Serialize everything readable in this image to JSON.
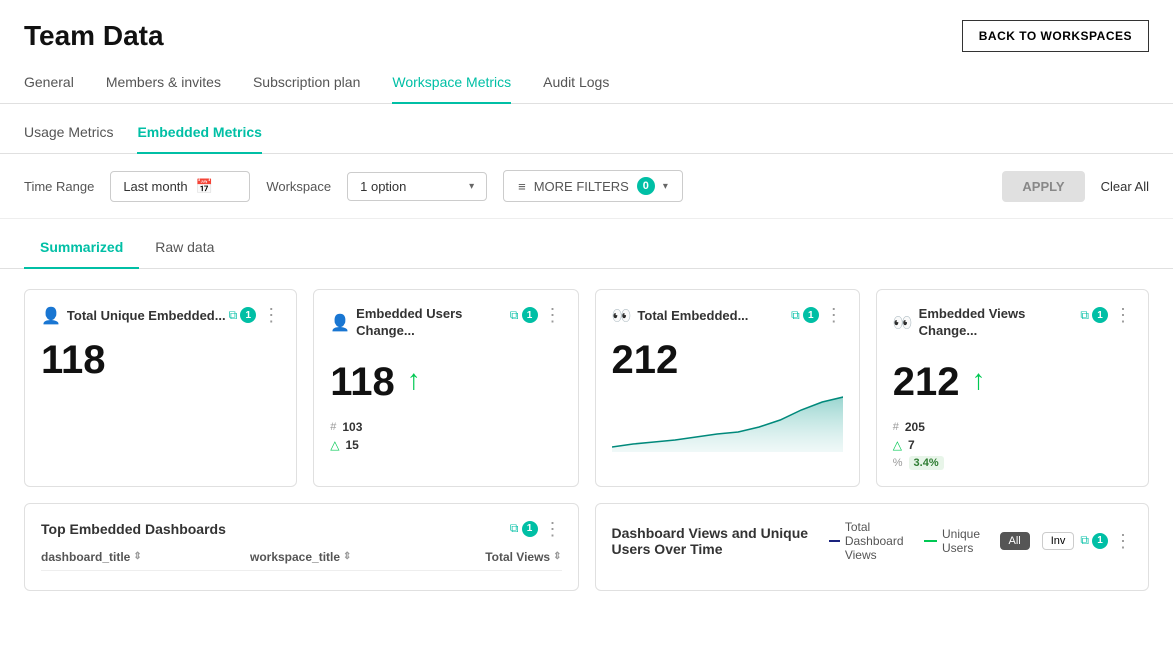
{
  "page": {
    "title": "Team Data",
    "back_button": "BACK TO WORKSPACES"
  },
  "nav": {
    "tabs": [
      {
        "id": "general",
        "label": "General",
        "active": false
      },
      {
        "id": "members",
        "label": "Members & invites",
        "active": false
      },
      {
        "id": "subscription",
        "label": "Subscription plan",
        "active": false
      },
      {
        "id": "workspace-metrics",
        "label": "Workspace Metrics",
        "active": true
      },
      {
        "id": "audit-logs",
        "label": "Audit Logs",
        "active": false
      }
    ]
  },
  "sub_tabs": [
    {
      "id": "usage",
      "label": "Usage Metrics",
      "active": false
    },
    {
      "id": "embedded",
      "label": "Embedded Metrics",
      "active": true
    }
  ],
  "filters": {
    "time_range_label": "Time Range",
    "time_range_value": "Last month",
    "workspace_label": "Workspace",
    "workspace_value": "1 option",
    "more_filters_label": "MORE FILTERS",
    "more_filters_count": "0",
    "apply_label": "APPLY",
    "clear_label": "Clear All"
  },
  "view_tabs": [
    {
      "id": "summarized",
      "label": "Summarized",
      "active": true
    },
    {
      "id": "raw",
      "label": "Raw data",
      "active": false
    }
  ],
  "metrics": [
    {
      "id": "total-unique-embedded",
      "icon": "👤",
      "title": "Total Unique Embedded...",
      "filter_count": "1",
      "value": "118",
      "has_trend": false,
      "has_chart": false,
      "has_sub": false
    },
    {
      "id": "embedded-users-change",
      "icon": "👤",
      "title": "Embedded Users Change...",
      "filter_count": "1",
      "value": "118",
      "trend": "up",
      "sub1_label": "#",
      "sub1_value": "103",
      "sub2_value": "15",
      "has_chart": false
    },
    {
      "id": "total-embedded",
      "icon": "👀",
      "title": "Total Embedded...",
      "filter_count": "1",
      "value": "212",
      "has_trend": false,
      "has_chart": true
    },
    {
      "id": "embedded-views-change",
      "icon": "👀",
      "title": "Embedded Views Change...",
      "filter_count": "1",
      "value": "212",
      "trend": "up",
      "sub1_label": "#",
      "sub1_value": "205",
      "sub2_value": "7",
      "sub3_value": "3.4%"
    }
  ],
  "bottom_cards": [
    {
      "id": "top-embedded-dashboards",
      "title": "Top Embedded Dashboards",
      "filter_count": "1",
      "columns": [
        "dashboard_title",
        "workspace_title",
        "Total Views"
      ]
    },
    {
      "id": "dashboard-views-over-time",
      "title": "Dashboard Views and Unique Users Over Time",
      "filter_count": "1",
      "legend": [
        {
          "label": "Total Dashboard Views",
          "color": "#1a237e"
        },
        {
          "label": "Unique Users",
          "color": "#00c853"
        }
      ],
      "legend_buttons": [
        "All",
        "Inv"
      ]
    }
  ],
  "colors": {
    "accent": "#00bfa5",
    "trend_up": "#00c853",
    "chart_fill": "#80cbc4",
    "chart_stroke": "#00897b"
  }
}
